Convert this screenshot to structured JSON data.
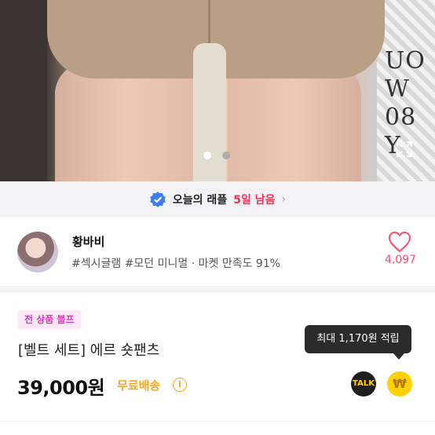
{
  "hero": {
    "print_text": "UO\nW\n08\nY",
    "dots_total": 2,
    "dots_active": 1
  },
  "raffle": {
    "label": "오늘의 래플",
    "days_left": "5일 남음",
    "icons": {
      "badge": "verified-badge-icon",
      "arrow": "chevron-right-icon"
    },
    "accent_color": "#ff2d55"
  },
  "seller": {
    "name": "황바비",
    "tags": "#섹시글램 #모던 미니멀 · 마켓 만족도 91%",
    "likes": "4,097",
    "like_color": "#ff4b6e"
  },
  "product": {
    "promo_badge": "전 상품 블프",
    "title": "[벨트 세트] 에르 숏팬츠",
    "price": "39,000원",
    "shipping": "무료배송",
    "shipping_color": "#f7a71c",
    "info_glyph": "i",
    "points_tooltip": "최대 1,170원 적립",
    "talk_label": "TALK",
    "pay_glyph": "₩"
  }
}
